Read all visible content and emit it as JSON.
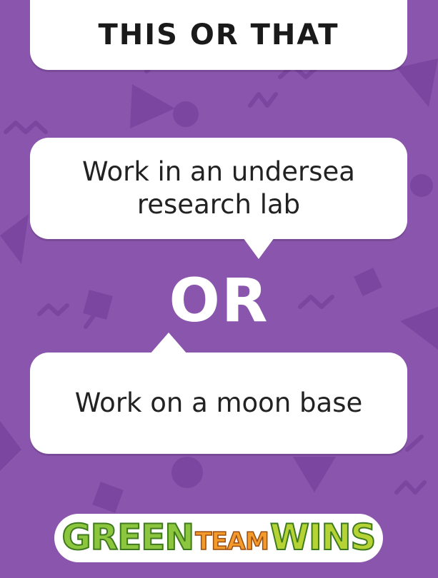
{
  "header": {
    "title": "THIS OR THAT"
  },
  "options": [
    {
      "text": "Work in an undersea research lab"
    },
    {
      "text": "Work on a moon base"
    }
  ],
  "separator": {
    "text": "OR"
  },
  "logo": {
    "word1": "GREEN",
    "word2": "TEAM",
    "word3": "WINS"
  },
  "colors": {
    "background": "#8a55ad",
    "pattern": "#7a46a0",
    "card": "#ffffff",
    "logo_green": "#8cc63f",
    "logo_orange": "#f39a2b"
  },
  "icons": [
    "triangle-shape",
    "zigzag-shape",
    "circle-shape",
    "square-shape"
  ]
}
